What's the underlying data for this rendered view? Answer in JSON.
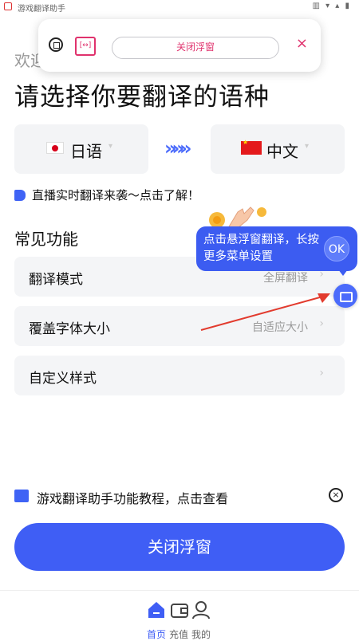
{
  "status_bar": {
    "app_name": "游戏翻译助手",
    "system_icons": "▥ ▾ ▴ ▮"
  },
  "float_panel": {
    "close_float_label": "关闭浮窗",
    "ratio_badge": "[↔]",
    "close_x": "×"
  },
  "welcome": "欢迎",
  "headline": "请选择你要翻译的语种",
  "language": {
    "source": "日语",
    "target": "中文",
    "caret": "▾",
    "swap": "»»»"
  },
  "promo_text": "直播实时翻译来袭～点击了解！",
  "section_title": "常见功能",
  "features": [
    {
      "label": "翻译模式",
      "value": "全屏翻译",
      "chevron": "›"
    },
    {
      "label": "覆盖字体大小",
      "value": "自适应大小",
      "chevron": "›"
    },
    {
      "label": "自定义样式",
      "value": "",
      "chevron": "›"
    }
  ],
  "tooltip": {
    "text": "点击悬浮窗翻译，长按更多菜单设置",
    "ok": "OK"
  },
  "guide": {
    "text": "游戏翻译助手功能教程，点击查看",
    "close": "×"
  },
  "main_button": "关闭浮窗",
  "tabs": [
    {
      "label": "首页"
    },
    {
      "label": "充值"
    },
    {
      "label": "我的"
    }
  ],
  "colors": {
    "accent": "#3f5ef5",
    "float_accent": "#e0326d",
    "tooltip_bg": "#3c5cf1"
  }
}
